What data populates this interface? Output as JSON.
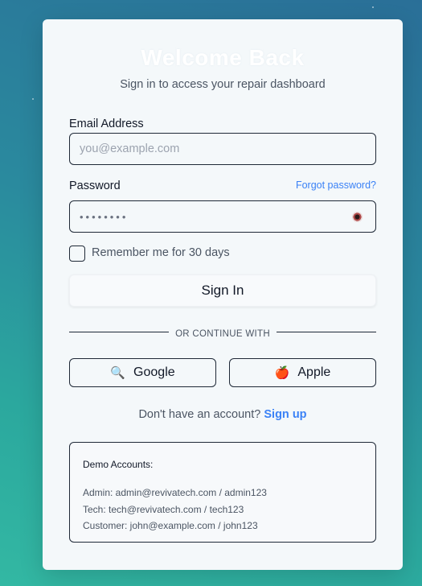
{
  "login": {
    "title": "Welcome Back",
    "subtitle": "Sign in to access your repair dashboard",
    "email_label": "Email Address",
    "email_placeholder": "you@example.com",
    "password_label": "Password",
    "forgot_link": "Forgot password?",
    "password_value": "••••••••",
    "remember_label": "Remember me for 30 days",
    "signin_label": "Sign In",
    "divider_text": "OR CONTINUE WITH",
    "google_label": "Google",
    "apple_label": "Apple",
    "no_account_text": "Don't have an account?",
    "signup_link": "Sign up"
  },
  "icons": {
    "google": "magnifier-icon",
    "apple": "apple-icon",
    "password_toggle": "eye-icon"
  },
  "demo": {
    "title": "Demo Accounts:",
    "accounts": [
      "Admin: admin@revivatech.com / admin123",
      "Tech: tech@revivatech.com / tech123",
      "Customer: john@example.com / john123"
    ]
  },
  "colors": {
    "accent": "#3b82f6",
    "card_bg": "#f4f8fa",
    "border": "#1f2937"
  }
}
